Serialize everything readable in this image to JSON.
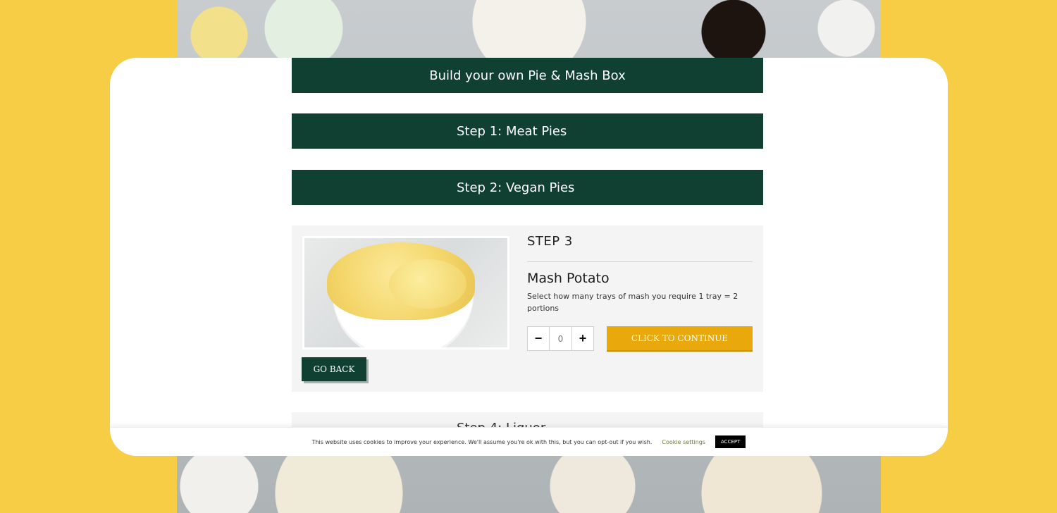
{
  "header": {
    "title": "Build your own Pie & Mash Box"
  },
  "steps": {
    "step1": "Step 1: Meat Pies",
    "step2": "Step 2: Vegan Pies",
    "step4": "Step 4: Liquor"
  },
  "step3": {
    "label": "STEP 3",
    "product_name": "Mash Potato",
    "description": "Select how many trays of mash you require 1 tray = 2 portions",
    "quantity": "0",
    "minus_symbol": "−",
    "plus_symbol": "+",
    "continue_label": "CLICK TO CONTINUE",
    "go_back_label": "GO BACK",
    "image_icon": "mash-potato-bowl"
  },
  "cookie": {
    "message": "This website uses cookies to improve your experience. We'll assume you're ok with this, but you can opt-out if you wish.",
    "settings_label": "Cookie settings",
    "accept_label": "ACCEPT"
  },
  "colors": {
    "background": "#f7cd45",
    "header_green": "#0f4032",
    "continue_orange": "#e9a80b",
    "panel_grey": "#f4f4f4"
  }
}
